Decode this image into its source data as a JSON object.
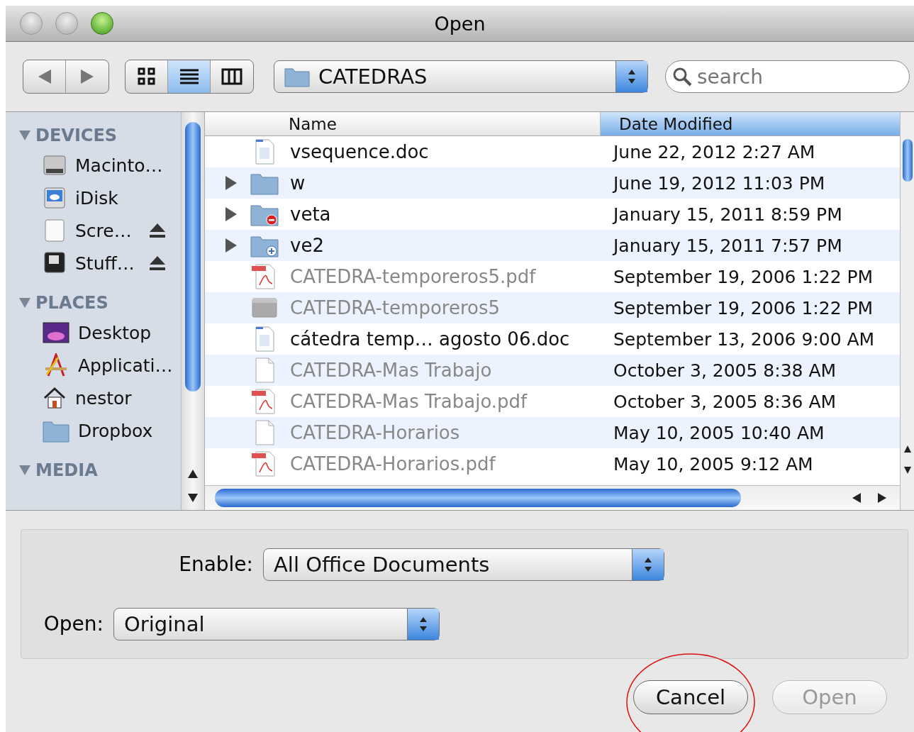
{
  "window": {
    "title": "Open"
  },
  "toolbar": {
    "view_modes": [
      {
        "kind": "icon",
        "selected": false
      },
      {
        "kind": "list",
        "selected": true
      },
      {
        "kind": "column",
        "selected": false
      }
    ],
    "location": "CATEDRAS",
    "search": {
      "placeholder": "search"
    }
  },
  "sidebar": {
    "sections": [
      {
        "title": "DEVICES",
        "items": [
          {
            "label": "Macinto…",
            "kind": "disk",
            "eject": false
          },
          {
            "label": "iDisk",
            "kind": "idisk",
            "eject": false
          },
          {
            "label": "Scre…",
            "kind": "volume",
            "eject": true
          },
          {
            "label": "Stuff…",
            "kind": "darkdisk",
            "eject": true
          }
        ]
      },
      {
        "title": "PLACES",
        "items": [
          {
            "label": "Desktop",
            "kind": "desktop",
            "eject": false
          },
          {
            "label": "Applicati…",
            "kind": "apps",
            "eject": false
          },
          {
            "label": "nestor",
            "kind": "home",
            "eject": false
          },
          {
            "label": "Dropbox",
            "kind": "folder",
            "eject": false
          }
        ]
      },
      {
        "title": "MEDIA"
      }
    ]
  },
  "table": {
    "columns": [
      {
        "label": "Name",
        "selected": false
      },
      {
        "label": "Date Modified",
        "selected": true
      }
    ],
    "rows": [
      {
        "name": "vsequence.doc",
        "date": "June 22, 2012 2:27 AM",
        "kind": "doc",
        "expandable": false,
        "dimmed": false
      },
      {
        "name": "w",
        "date": "June 19, 2012 11:03 PM",
        "kind": "folder",
        "expandable": true,
        "dimmed": false
      },
      {
        "name": "veta",
        "date": "January 15, 2011 8:59 PM",
        "kind": "folder-minus",
        "expandable": true,
        "dimmed": false
      },
      {
        "name": "ve2",
        "date": "January 15, 2011 7:57 PM",
        "kind": "folder-plus",
        "expandable": true,
        "dimmed": false
      },
      {
        "name": "CATEDRA-temporeros5.pdf",
        "date": "September 19, 2006 1:22 PM",
        "kind": "pdf",
        "expandable": false,
        "dimmed": true
      },
      {
        "name": "CATEDRA-temporeros5",
        "date": "September 19, 2006 1:22 PM",
        "kind": "app",
        "expandable": false,
        "dimmed": true
      },
      {
        "name": "cátedra temp… agosto 06.doc",
        "date": "September 13, 2006 9:00 AM",
        "kind": "doc",
        "expandable": false,
        "dimmed": false
      },
      {
        "name": "CATEDRA-Mas Trabajo",
        "date": "October 3, 2005 8:38 AM",
        "kind": "blank",
        "expandable": false,
        "dimmed": true
      },
      {
        "name": "CATEDRA-Mas Trabajo.pdf",
        "date": "October 3, 2005 8:36 AM",
        "kind": "pdf",
        "expandable": false,
        "dimmed": true
      },
      {
        "name": "CATEDRA-Horarios",
        "date": "May 10, 2005 10:40 AM",
        "kind": "blank",
        "expandable": false,
        "dimmed": true
      },
      {
        "name": "CATEDRA-Horarios.pdf",
        "date": "May 10, 2005 9:12 AM",
        "kind": "pdf",
        "expandable": false,
        "dimmed": true
      }
    ]
  },
  "options": [
    {
      "label": "Enable:",
      "value": "All Office Documents"
    },
    {
      "label": "Open:",
      "value": "Original"
    }
  ],
  "buttons": [
    {
      "label": "Cancel",
      "disabled": false
    },
    {
      "label": "Open",
      "disabled": true
    }
  ],
  "annotations": [
    {
      "kind": "circle"
    }
  ]
}
